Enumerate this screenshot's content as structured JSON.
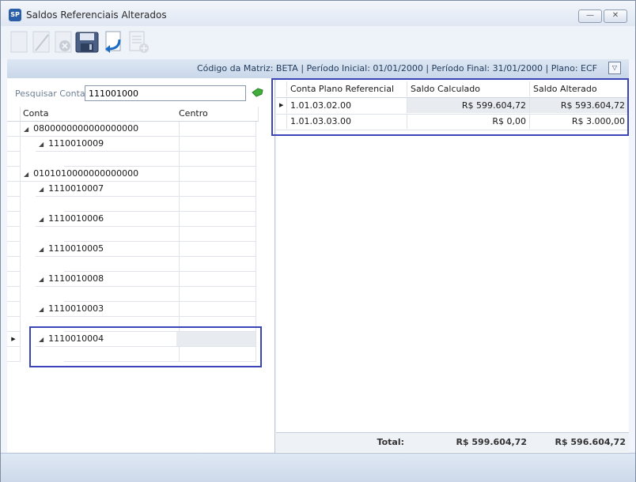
{
  "window": {
    "title": "Saldos Referenciais Alterados",
    "icon_text": "SP",
    "minimize_glyph": "—",
    "close_glyph": "✕"
  },
  "toolbar": {
    "buttons": [
      {
        "name": "new-icon",
        "enabled": false
      },
      {
        "name": "edit-icon",
        "enabled": false
      },
      {
        "name": "delete-icon",
        "enabled": false
      },
      {
        "name": "save-icon",
        "enabled": true
      },
      {
        "name": "undo-icon",
        "enabled": true
      },
      {
        "name": "report-icon",
        "enabled": false
      }
    ]
  },
  "infobar": {
    "text": "Código da Matriz: BETA | Período Inicial: 01/01/2000 | Período Final: 31/01/2000 | Plano: ECF",
    "collapse_glyph": "▽"
  },
  "search": {
    "label": "Pesquisar Conta",
    "value": "111001000"
  },
  "tree": {
    "columns": {
      "conta": "Conta",
      "centro": "Centro"
    },
    "rows": [
      {
        "label": "0800000000000000000",
        "level": 0,
        "selected": false
      },
      {
        "label": "1110010009",
        "level": 1,
        "selected": false
      },
      {
        "label": "",
        "level": 2,
        "selected": false
      },
      {
        "label": "0101010000000000000",
        "level": 0,
        "selected": false
      },
      {
        "label": "1110010007",
        "level": 1,
        "selected": false
      },
      {
        "label": "",
        "level": 2,
        "selected": false
      },
      {
        "label": "1110010006",
        "level": 1,
        "selected": false
      },
      {
        "label": "",
        "level": 2,
        "selected": false
      },
      {
        "label": "1110010005",
        "level": 1,
        "selected": false
      },
      {
        "label": "",
        "level": 2,
        "selected": false
      },
      {
        "label": "1110010008",
        "level": 1,
        "selected": false
      },
      {
        "label": "",
        "level": 2,
        "selected": false
      },
      {
        "label": "1110010003",
        "level": 1,
        "selected": false
      },
      {
        "label": "",
        "level": 2,
        "selected": false
      },
      {
        "label": "1110010004",
        "level": 1,
        "selected": true
      },
      {
        "label": "",
        "level": 2,
        "selected": false
      }
    ]
  },
  "grid": {
    "columns": {
      "conta": "Conta Plano Referencial",
      "calculado": "Saldo Calculado",
      "alterado": "Saldo Alterado"
    },
    "rows": [
      {
        "conta": "1.01.03.02.00",
        "calculado": "R$ 599.604,72",
        "alterado": "R$ 593.604,72",
        "selected": true
      },
      {
        "conta": "1.01.03.03.00",
        "calculado": "R$ 0,00",
        "alterado": "R$ 3.000,00",
        "selected": false
      }
    ],
    "footer": {
      "label": "Total:",
      "calculado": "R$ 599.604,72",
      "alterado": "R$ 596.604,72"
    }
  },
  "colors": {
    "callout": "#3b45b8",
    "selected_row": "#e8ebf0"
  }
}
